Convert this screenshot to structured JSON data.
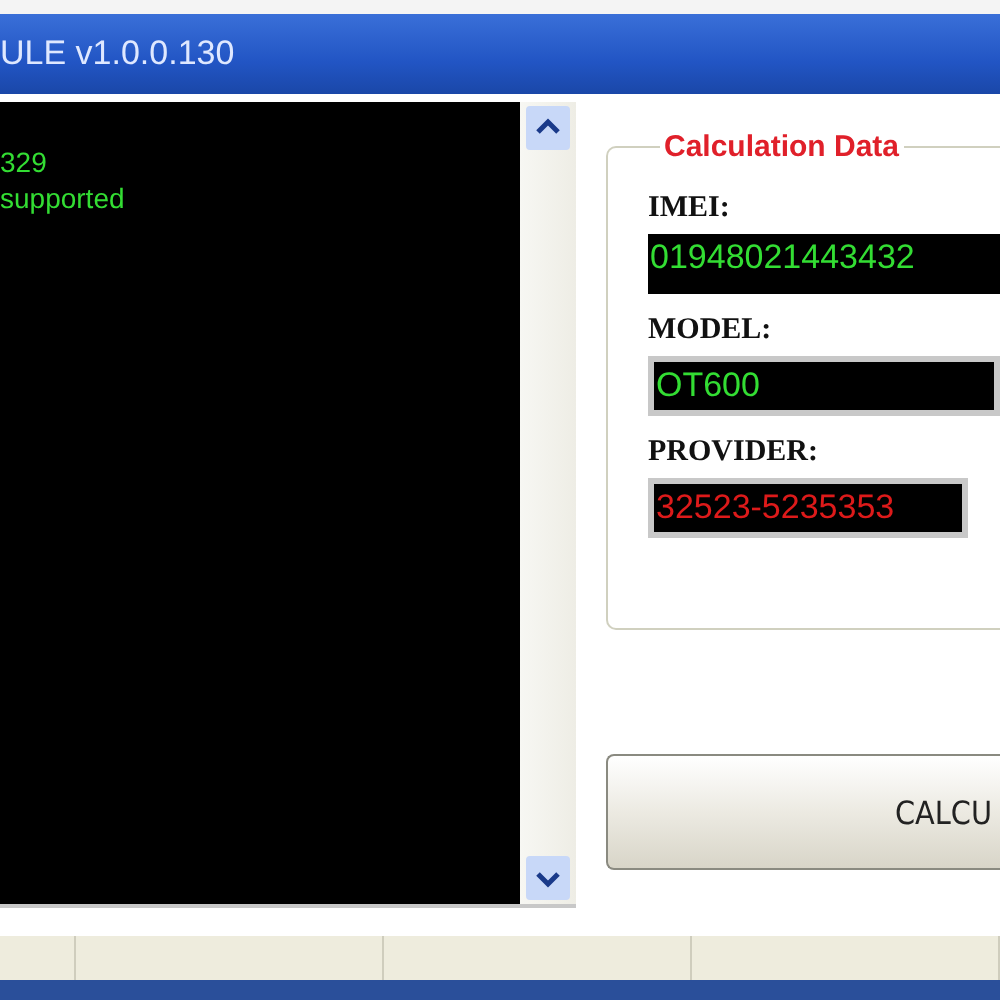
{
  "window": {
    "title": "ULE v1.0.0.130"
  },
  "log": {
    "lines": [
      "329",
      "supported"
    ]
  },
  "calculation_data": {
    "title": "Calculation Data",
    "fields": [
      {
        "label": "IMEI:",
        "value": "01948021443432",
        "kind": "dark"
      },
      {
        "label": "MODEL:",
        "value": "OT600",
        "kind": "framed"
      },
      {
        "label": "PROVIDER:",
        "value": "32523-5235353",
        "kind": "alert"
      }
    ]
  },
  "buttons": [
    {
      "label": "CALCU"
    }
  ]
}
